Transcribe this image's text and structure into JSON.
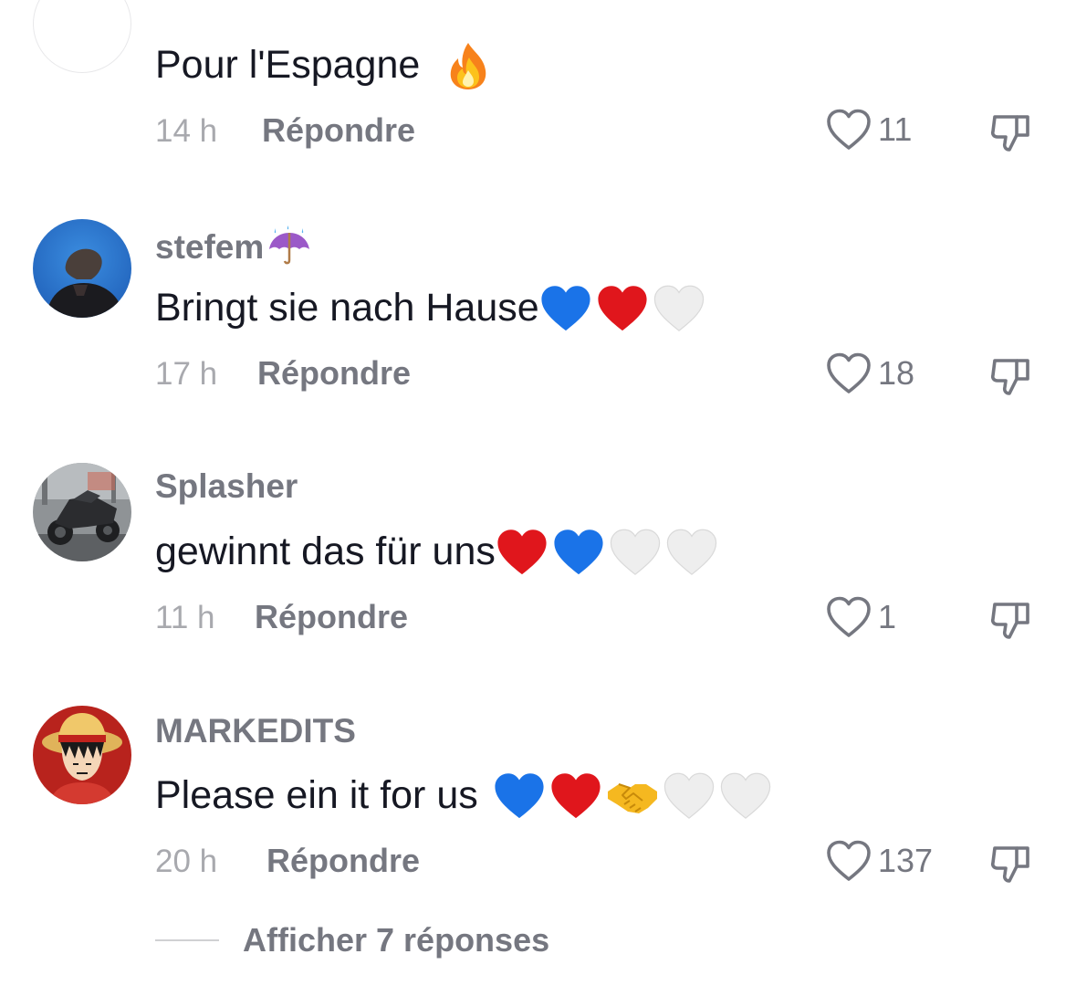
{
  "comments": [
    {
      "username": "",
      "text": "Pour l'Espagne",
      "emojis": [
        "fire"
      ],
      "time": "14 h",
      "reply_label": "Répondre",
      "likes": "11"
    },
    {
      "username": "stefem",
      "username_emoji": "umbrella-rain",
      "text": "Bringt sie nach Hause",
      "emojis": [
        "blue-heart",
        "red-heart",
        "white-heart"
      ],
      "time": "17 h",
      "reply_label": "Répondre",
      "likes": "18"
    },
    {
      "username": "Splasher",
      "text": "gewinnt das für uns",
      "emojis": [
        "red-heart",
        "blue-heart",
        "white-heart",
        "white-heart"
      ],
      "time": "11 h",
      "reply_label": "Répondre",
      "likes": "1"
    },
    {
      "username": "MARKEDITS",
      "text": "Please ein it for us",
      "emojis": [
        "blue-heart",
        "red-heart",
        "handshake",
        "white-heart",
        "white-heart"
      ],
      "time": "20 h",
      "reply_label": "Répondre",
      "likes": "137"
    }
  ],
  "show_replies_label": "Afficher 7 réponses",
  "colors": {
    "primary_text": "#161823",
    "secondary_text": "#757780",
    "muted_text": "#a8a9ae"
  }
}
